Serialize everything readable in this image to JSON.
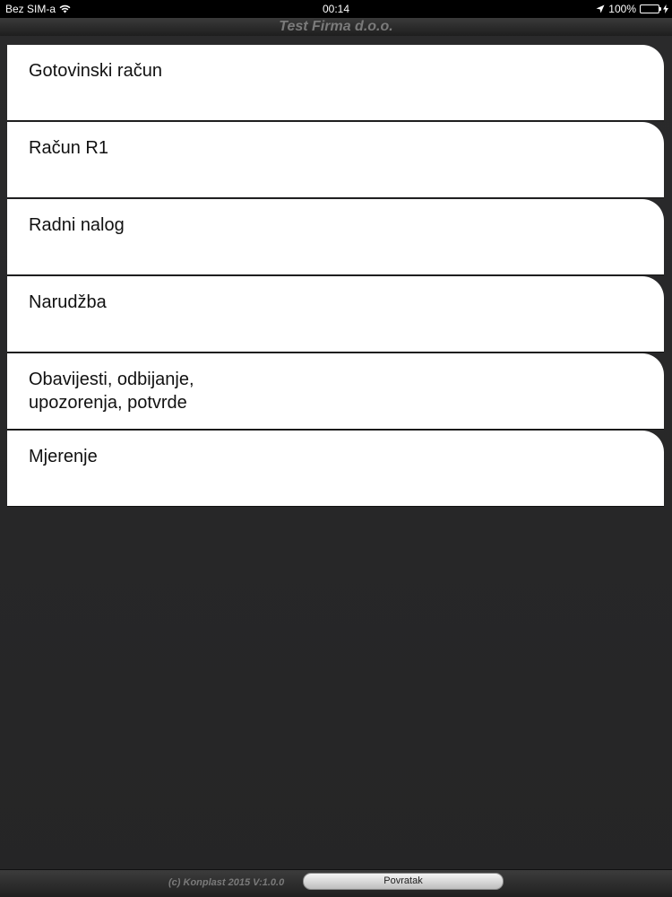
{
  "status_bar": {
    "carrier": "Bez SIM-a",
    "time": "00:14",
    "battery": "100%",
    "icons": [
      "wifi-icon",
      "location-icon",
      "battery-icon",
      "charging-icon"
    ]
  },
  "title": "Test Firma d.o.o.",
  "menu": {
    "items": [
      {
        "label": "Gotovinski račun"
      },
      {
        "label": "Račun R1"
      },
      {
        "label": "Radni nalog"
      },
      {
        "label": "Narudžba"
      },
      {
        "label": "Obavijesti, odbijanje,\nupozorenja, potvrde"
      },
      {
        "label": "Mjerenje"
      }
    ]
  },
  "footer": {
    "copyright": "(c) Konplast 2015 V:1.0.0",
    "back_label": "Povratak"
  },
  "colors": {
    "background": "#262627",
    "battery": "#4cd964",
    "title_text": "#7a7a7a"
  }
}
